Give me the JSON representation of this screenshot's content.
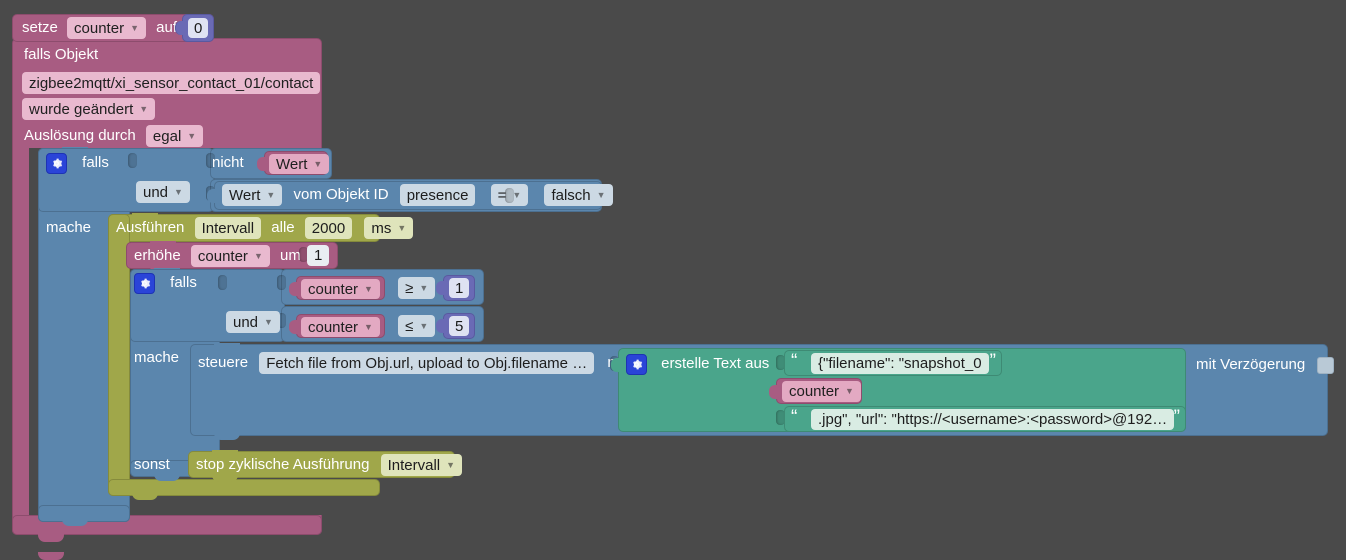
{
  "app": {
    "kind": "blockly-visual-program",
    "language": "de",
    "canvas_background": "#4a4a4a"
  },
  "colors": {
    "variable_block": "#a85c82",
    "trigger_block": "#a85c82",
    "logic_block": "#5b86ad",
    "loop_block": "#a0a74a",
    "text_block": "#4aa58b",
    "number_block": "#6a6ab5",
    "mutator_icon": "#2a44d8"
  },
  "program": {
    "set_counter": {
      "keyword": "setze",
      "variable": "counter",
      "assign_word": "auf",
      "value": "0"
    },
    "trigger": {
      "line1": "falls Objekt",
      "object_id": "zigbee2mqtt/xi_sensor_contact_01/contact",
      "condition": "wurde geändert",
      "trigger_by_label": "Auslösung durch",
      "trigger_by_value": "egal"
    },
    "outer_if": {
      "if_label": "falls",
      "and_label": "und",
      "not_label": "nicht",
      "not_value": "Wert",
      "compare": {
        "left_value": "Wert",
        "middle_label": "vom Objekt ID",
        "object_id": "presence",
        "operator": "=",
        "right_value": "falsch"
      },
      "do_label": "mache"
    },
    "interval": {
      "run_label": "Ausführen",
      "name": "Intervall",
      "every_label": "alle",
      "period": "2000",
      "unit": "ms"
    },
    "increment": {
      "keyword": "erhöhe",
      "variable": "counter",
      "by_label": "um",
      "amount": "1"
    },
    "inner_if": {
      "if_label": "falls",
      "and_label": "und",
      "cond1": {
        "variable": "counter",
        "operator": "≥",
        "value": "1"
      },
      "cond2": {
        "variable": "counter",
        "operator": "≤",
        "value": "5"
      },
      "do_label": "mache",
      "else_label": "sonst"
    },
    "control": {
      "keyword": "steuere",
      "target": "Fetch file from Obj.url, upload to Obj.filename …",
      "with_label": "mit",
      "delay_label": "mit Verzögerung",
      "delay_checked": false
    },
    "text_join": {
      "label": "erstelle Text aus",
      "parts": [
        {
          "type": "text",
          "value": "{\"filename\": \"snapshot_0"
        },
        {
          "type": "variable",
          "value": "counter"
        },
        {
          "type": "text",
          "value": ".jpg\", \"url\": \"https://<username>:<password>@192…"
        }
      ]
    },
    "stop_interval": {
      "keyword": "stop zyklische Ausführung",
      "name": "Intervall"
    }
  }
}
